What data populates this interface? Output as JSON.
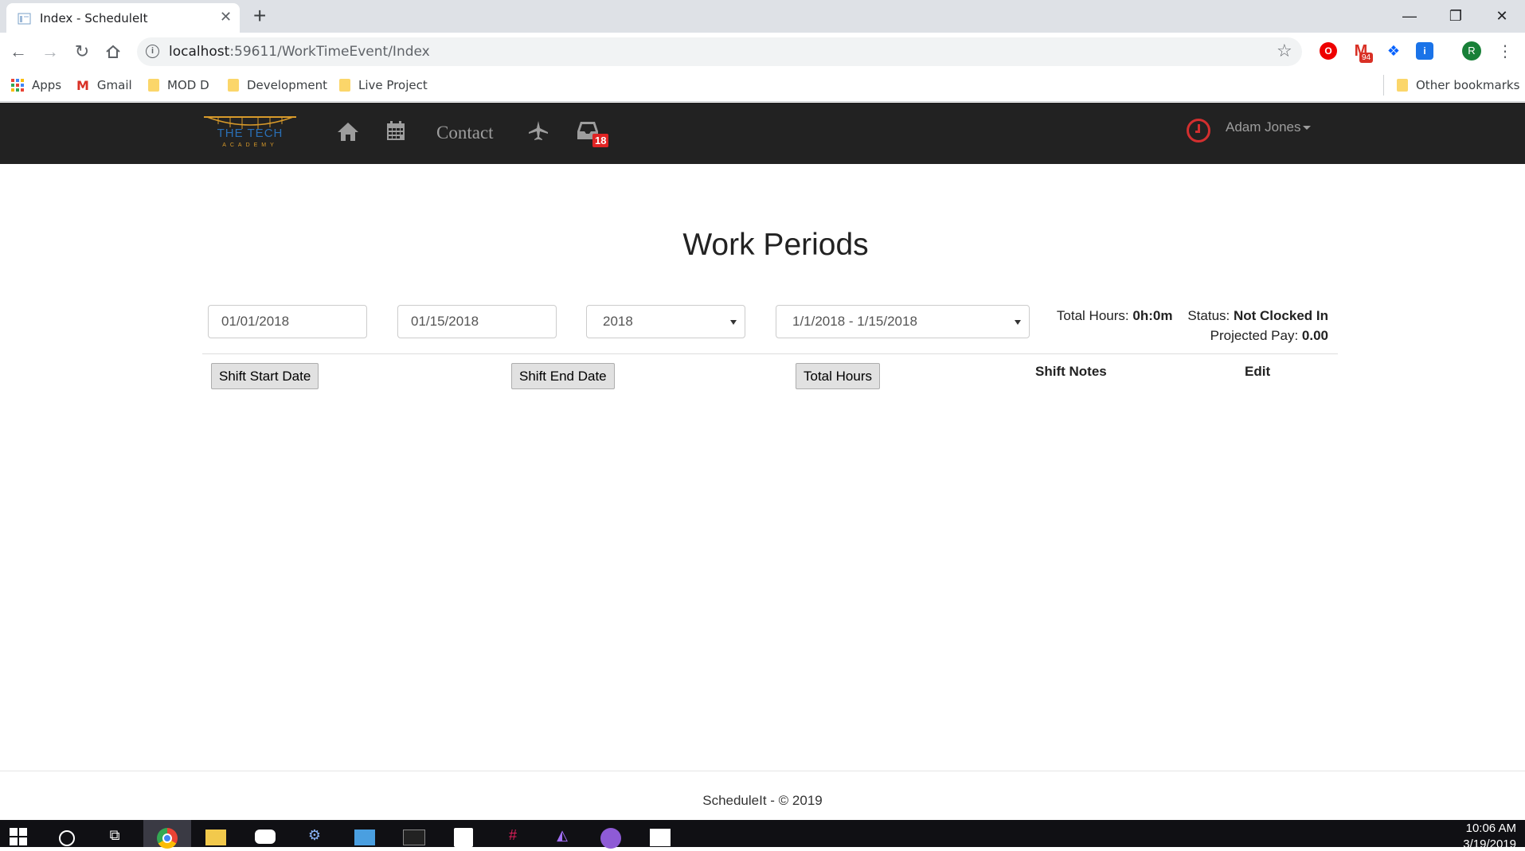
{
  "browser": {
    "tab_title": "Index - ScheduleIt",
    "close_glyph": "✕",
    "new_tab_glyph": "+",
    "url_host": "localhost",
    "url_path": ":59611/WorkTimeEvent/Index",
    "ext_badge": "94",
    "profile_letter": "R",
    "bookmarks": {
      "apps": "Apps",
      "gmail": "Gmail",
      "mod_d": "MOD D",
      "development": "Development",
      "live_project": "Live Project",
      "other": "Other bookmarks"
    }
  },
  "navbar": {
    "logo_line1": "THE TECH",
    "logo_line2": "ACADEMY",
    "contact": "Contact",
    "inbox_count": "18",
    "user_name": "Adam Jones",
    "icons": [
      "home-icon",
      "calendar-icon",
      "airplane-icon",
      "inbox-icon",
      "clock-icon"
    ]
  },
  "page": {
    "title": "Work Periods",
    "start_date": "01/01/2018",
    "end_date": "01/15/2018",
    "year": "2018",
    "period": "1/1/2018 - 1/15/2018",
    "summary": {
      "total_hours_label": "Total Hours: ",
      "total_hours_value": "0h:0m",
      "status_label": "Status: ",
      "status_value": "Not Clocked In",
      "projected_pay_label": "Projected Pay: ",
      "projected_pay_value": "0.00"
    },
    "columns": {
      "shift_start": "Shift Start Date",
      "shift_end": "Shift End Date",
      "total_hours": "Total Hours",
      "shift_notes": "Shift Notes",
      "edit": "Edit"
    },
    "footer": "ScheduleIt - © 2019"
  },
  "taskbar": {
    "time": "10:06 AM",
    "date": "3/19/2019"
  },
  "colors": {
    "navbar_bg": "#222222",
    "badge_red": "#e02424",
    "clock_red": "#d32f2f",
    "logo_gold": "#d89a2a",
    "logo_blue": "#2a6fb5"
  }
}
